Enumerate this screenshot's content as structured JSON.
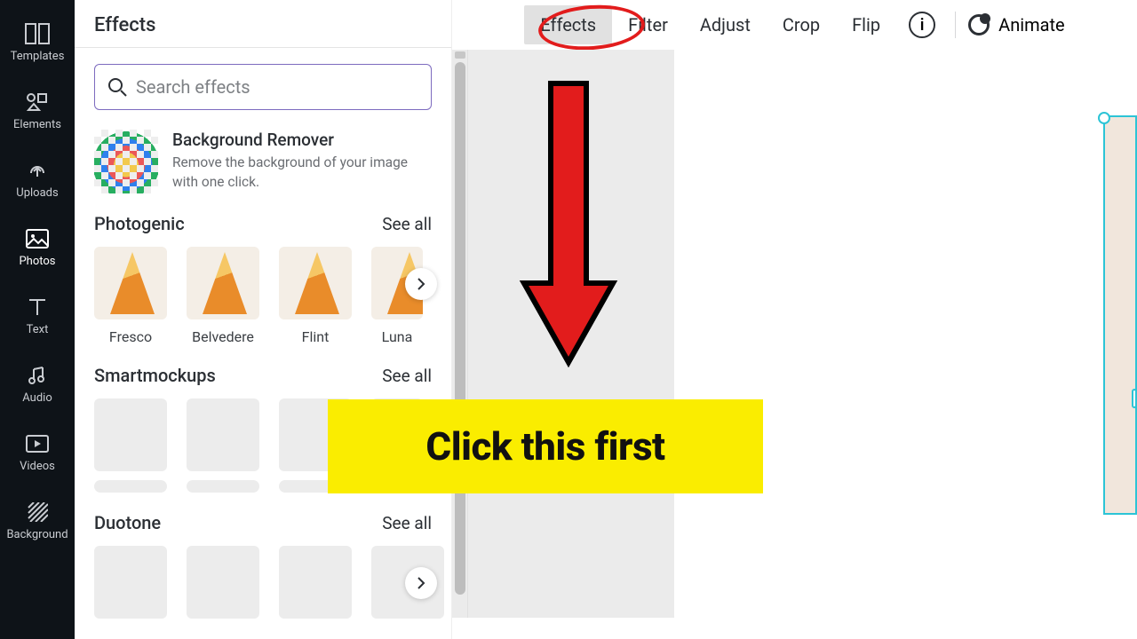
{
  "rail": {
    "items": [
      {
        "label": "Templates"
      },
      {
        "label": "Elements"
      },
      {
        "label": "Uploads"
      },
      {
        "label": "Photos"
      },
      {
        "label": "Text"
      },
      {
        "label": "Audio"
      },
      {
        "label": "Videos"
      },
      {
        "label": "Background"
      }
    ]
  },
  "panel": {
    "title": "Effects",
    "search_placeholder": "Search effects",
    "bg_remover": {
      "title": "Background Remover",
      "desc": "Remove the background of your image with one click."
    },
    "sections": {
      "photogenic": {
        "name": "Photogenic",
        "see_all": "See all",
        "items": [
          "Fresco",
          "Belvedere",
          "Flint",
          "Luna"
        ]
      },
      "smartmockups": {
        "name": "Smartmockups",
        "see_all": "See all"
      },
      "duotone": {
        "name": "Duotone",
        "see_all": "See all"
      }
    }
  },
  "topbar": {
    "effects": "Effects",
    "filter": "Filter",
    "adjust": "Adjust",
    "crop": "Crop",
    "flip": "Flip",
    "animate": "Animate"
  },
  "annotation": {
    "callout": "Click this first"
  }
}
